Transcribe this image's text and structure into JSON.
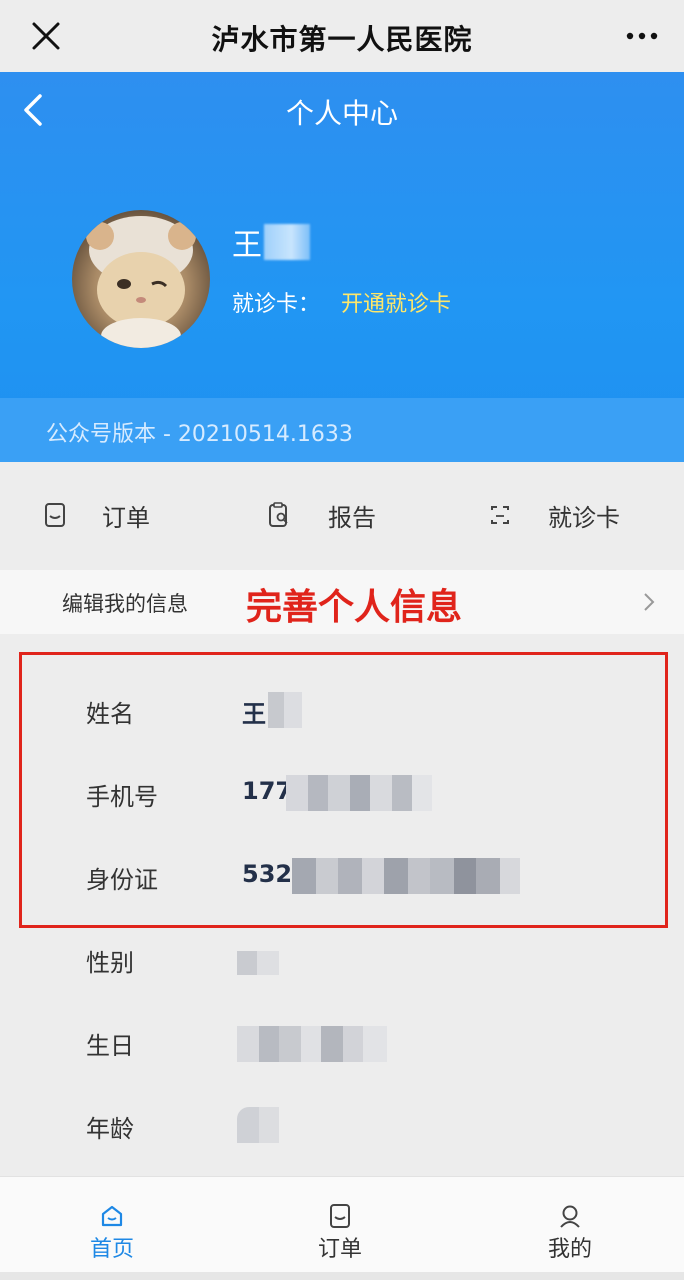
{
  "wechat": {
    "title": "泸水市第一人民医院"
  },
  "header": {
    "title": "个人中心",
    "user_name_visible": "王",
    "card_label": "就诊卡：",
    "card_action": "开通就诊卡",
    "version": "公众号版本 - 20210514.1633"
  },
  "quick_menu": [
    {
      "label": "订单",
      "icon": "order-icon"
    },
    {
      "label": "报告",
      "icon": "report-icon"
    },
    {
      "label": "就诊卡",
      "icon": "card-icon"
    }
  ],
  "edit": {
    "label": "编辑我的信息",
    "annotation": "完善个人信息"
  },
  "info": [
    {
      "label": "姓名",
      "value": "王"
    },
    {
      "label": "手机号",
      "value": "177"
    },
    {
      "label": "身份证",
      "value": "532"
    },
    {
      "label": "性别",
      "value": ""
    },
    {
      "label": "生日",
      "value": ""
    },
    {
      "label": "年龄",
      "value": ""
    }
  ],
  "tabbar": [
    {
      "label": "首页",
      "icon": "home-icon",
      "active": true
    },
    {
      "label": "订单",
      "icon": "order-icon",
      "active": false
    },
    {
      "label": "我的",
      "icon": "profile-icon",
      "active": false
    }
  ],
  "colors": {
    "primary_blue": "#2196f3",
    "accent_yellow": "#ffe76a",
    "annotation_red": "#e0241b",
    "active_tab": "#1e88e5"
  }
}
